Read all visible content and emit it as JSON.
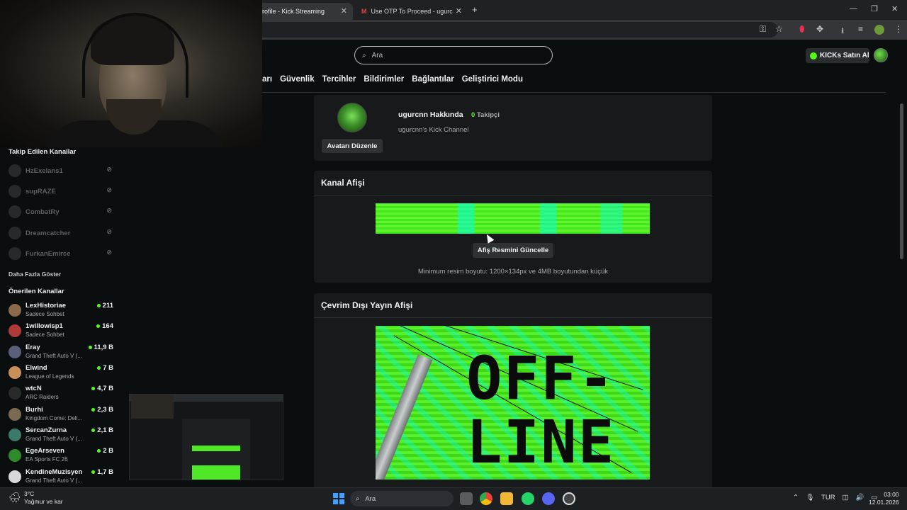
{
  "browser": {
    "tabs": [
      {
        "label": "rofile - Kick Streaming",
        "active": true
      },
      {
        "label": "Use OTP To Proceed - ugurcan",
        "active": false
      }
    ],
    "new_tab": "+",
    "window_controls": [
      "—",
      "❐",
      "✕"
    ]
  },
  "header": {
    "search_placeholder": "Ara",
    "kicks_button": "KICKs Satın Al",
    "brand_color": "#53fc18"
  },
  "settings_nav": [
    "arı",
    "Güvenlik",
    "Tercihler",
    "Bildirimler",
    "Bağlantılar",
    "Geliştirici Modu"
  ],
  "sidebar": {
    "followed_title": "Takip Edilen Kanallar",
    "followed": [
      "HzExelans1",
      "supRAZE",
      "CombatRy",
      "Dreamcatcher",
      "FurkanEmirce"
    ],
    "show_more": "Daha Fazla Göster",
    "recommended_title": "Önerilen Kanallar",
    "recommended": [
      {
        "name": "LexHistoriae",
        "category": "Sadece Sohbet",
        "viewers": "211",
        "color": "#8a6a4a"
      },
      {
        "name": "1willowisp1",
        "category": "Sadece Sohbet",
        "viewers": "164",
        "color": "#b03a3a"
      },
      {
        "name": "Eray",
        "category": "Grand Theft Auto V (...",
        "viewers": "11,9 B",
        "color": "#5a5f7a"
      },
      {
        "name": "Elwind",
        "category": "League of Legends",
        "viewers": "7 B",
        "color": "#c98f5a"
      },
      {
        "name": "wtcN",
        "category": "ARC Raiders",
        "viewers": "4,7 B",
        "color": "#2a2a2a"
      },
      {
        "name": "Burhi",
        "category": "Kingdom Come: Deli...",
        "viewers": "2,3 B",
        "color": "#7a6a52"
      },
      {
        "name": "SercanZurna",
        "category": "Grand Theft Auto V (...",
        "viewers": "2,1 B",
        "color": "#3a7a6a"
      },
      {
        "name": "EgeArseven",
        "category": "EA Sports FC 26",
        "viewers": "2 B",
        "color": "#2f8a2a"
      },
      {
        "name": "KendineMuzisyen",
        "category": "Grand Theft Auto V (...",
        "viewers": "1,7 B",
        "color": "#d8d8d8"
      }
    ]
  },
  "profile": {
    "about": "ugurcnn Hakkında",
    "followers_count": "0",
    "followers_label": "Takipçi",
    "description": "ugurcnn's Kick Channel",
    "edit_avatar": "Avatarı Düzenle"
  },
  "banner": {
    "title": "Kanal Afişi",
    "update_button": "Afiş Resmini Güncelle",
    "hint": "Minimum resim boyutu: 1200×134px ve 4MB boyutundan küçük"
  },
  "offline": {
    "title": "Çevrim Dışı Yayın Afişi",
    "line1": "OFF-",
    "line2": "LINE"
  },
  "taskbar": {
    "temperature": "3°C",
    "weather": "Yağmur ve kar",
    "search": "Ara",
    "language": "TUR",
    "time": "03:00",
    "date": "12.01.2026"
  }
}
